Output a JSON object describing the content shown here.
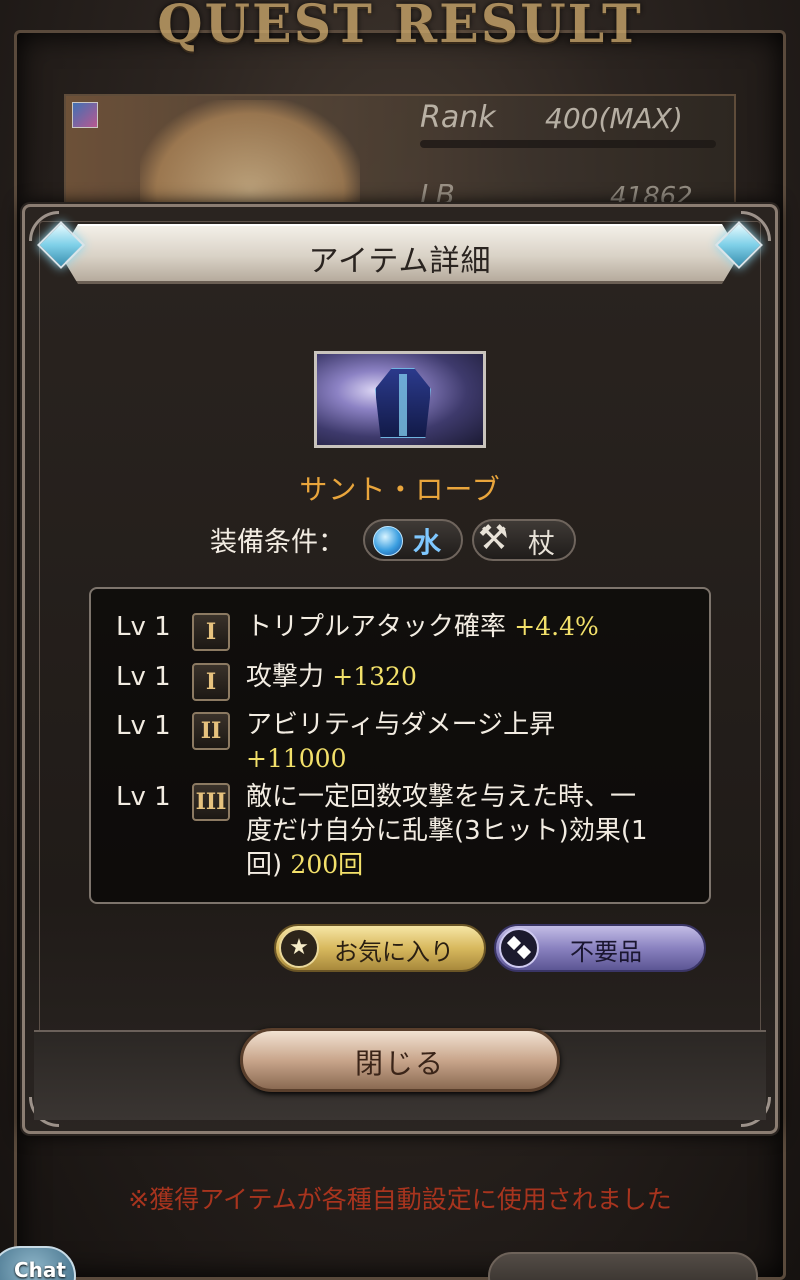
{
  "background": {
    "quest_title": "QUEST RESULT",
    "rank_label": "Rank",
    "rank_value": "400(MAX)",
    "lb_label": "LB",
    "lb_value": "41862",
    "notice": "※獲得アイテムが各種自動設定に使用されました",
    "chat_label": "Chat"
  },
  "dialog": {
    "title": "アイテム詳細",
    "item_name": "サント・ローブ",
    "equip_label": "装備条件：",
    "equip_element": "水",
    "equip_weapon": "杖",
    "skills": [
      {
        "level": "Lv 1",
        "tier": "I",
        "name": "トリプルアタック確率",
        "value": "+4.4%"
      },
      {
        "level": "Lv 1",
        "tier": "I",
        "name": "攻撃力",
        "value": "+1320"
      },
      {
        "level": "Lv 1",
        "tier": "II",
        "name": "アビリティ与ダメージ上昇",
        "value": "+11000"
      },
      {
        "level": "Lv 1",
        "tier": "III",
        "name_line1": "敵に一定回数攻撃を与えた時、一",
        "name_line2": "度だけ自分に乱撃(3ヒット)効果(1",
        "name_line3": "回)",
        "value": "200回"
      }
    ],
    "favorite_label": "お気に入り",
    "junk_label": "不要品",
    "close_label": "閉じる"
  },
  "colors": {
    "item_name": "#e9a53c",
    "skill_value": "#f2e06a",
    "notice": "#a8341e"
  }
}
